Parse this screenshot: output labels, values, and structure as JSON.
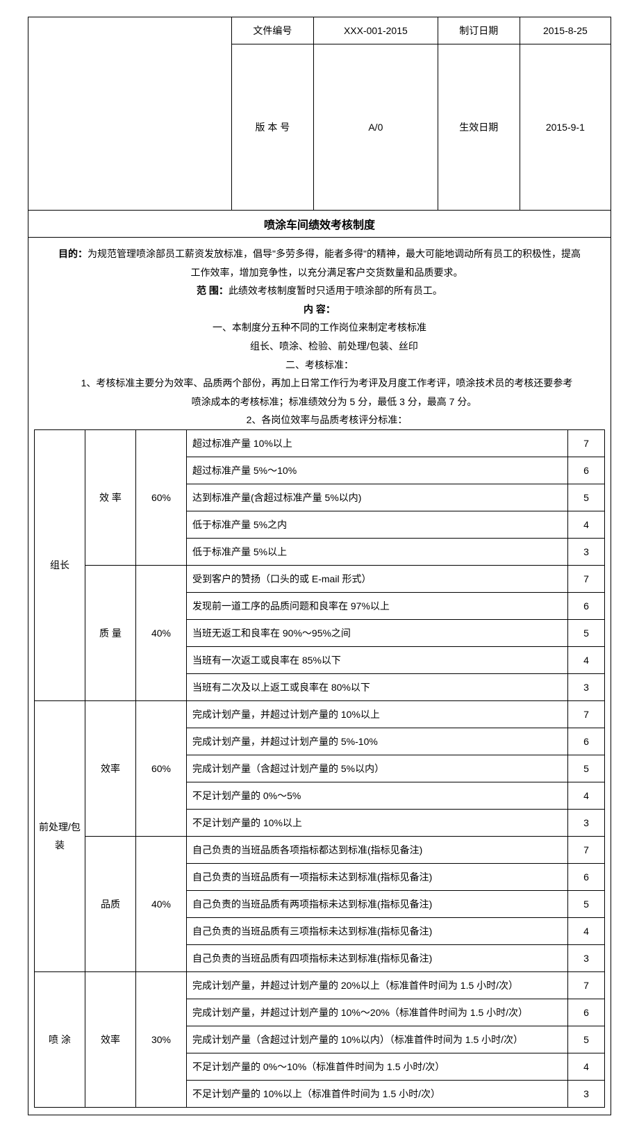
{
  "header": {
    "doc_no_label": "文件编号",
    "doc_no_value": "XXX-001-2015",
    "rev_date_label": "制订日期",
    "rev_date_value": "2015-8-25",
    "version_label": "版 本 号",
    "version_value": "A/0",
    "eff_date_label": "生效日期",
    "eff_date_value": "2015-9-1",
    "title": "喷涂车间绩效考核制度"
  },
  "body": {
    "purpose_label": "目的：",
    "purpose_text_1": "为规范管理喷涂部员工薪资发放标准，倡导\"多劳多得，能者多得\"的精神，最大可能地调动所有员工的积极性，提高",
    "purpose_text_2": "工作效率，增加竞争性，以充分满足客户交货数量和品质要求。",
    "scope_label": "范 围：",
    "scope_text": "此绩效考核制度暂时只适用于喷涂部的所有员工。",
    "content_label": "内 容：",
    "sec1": "一、本制度分五种不同的工作岗位来制定考核标准",
    "sec1_items": "组长、喷涂、检验、前处理/包装、丝印",
    "sec2": "二、考核标准：",
    "sec2_1a": "1、考核标准主要分为效率、品质两个部份，再加上日常工作行为考评及月度工作考评，喷涂技术员的考核还要参考",
    "sec2_1b": "喷涂成本的考核标准；标准绩效分为 5 分，最低 3 分，最高 7 分。",
    "sec2_2": "2、各岗位效率与品质考核评分标准："
  },
  "eval": {
    "groups": [
      {
        "role": "组长",
        "metrics": [
          {
            "name": "效 率",
            "pct": "60%",
            "rows": [
              {
                "desc": "超过标准产量 10%以上",
                "score": "7"
              },
              {
                "desc": "超过标准产量 5%～10%",
                "score": "6"
              },
              {
                "desc": "达到标准产量(含超过标准产量 5%以内)",
                "score": "5"
              },
              {
                "desc": "低于标准产量 5%之内",
                "score": "4"
              },
              {
                "desc": "低于标准产量 5%以上",
                "score": "3"
              }
            ]
          },
          {
            "name": "质 量",
            "pct": "40%",
            "rows": [
              {
                "desc": "受到客户的赞扬（口头的或 E-mail 形式）",
                "score": "7"
              },
              {
                "desc": "发现前一道工序的品质问题和良率在 97%以上",
                "score": "6"
              },
              {
                "desc": "当班无返工和良率在 90%～95%之间",
                "score": "5"
              },
              {
                "desc": "当班有一次返工或良率在 85%以下",
                "score": "4"
              },
              {
                "desc": "当班有二次及以上返工或良率在 80%以下",
                "score": "3"
              }
            ]
          }
        ]
      },
      {
        "role": "前处理/包装",
        "metrics": [
          {
            "name": "效率",
            "pct": "60%",
            "rows": [
              {
                "desc": "完成计划产量，并超过计划产量的 10%以上",
                "score": "7"
              },
              {
                "desc": "完成计划产量，并超过计划产量的 5%-10%",
                "score": "6"
              },
              {
                "desc": "完成计划产量（含超过计划产量的 5%以内）",
                "score": "5"
              },
              {
                "desc": "不足计划产量的 0%～5%",
                "score": "4"
              },
              {
                "desc": "不足计划产量的 10%以上",
                "score": "3"
              }
            ]
          },
          {
            "name": "品质",
            "pct": "40%",
            "rows": [
              {
                "desc": "自己负责的当班品质各项指标都达到标准(指标见备注)",
                "score": "7"
              },
              {
                "desc": "自己负责的当班品质有一项指标未达到标准(指标见备注)",
                "score": "6"
              },
              {
                "desc": "自己负责的当班品质有两项指标未达到标准(指标见备注)",
                "score": "5"
              },
              {
                "desc": "自己负责的当班品质有三项指标未达到标准(指标见备注)",
                "score": "4"
              },
              {
                "desc": "自己负责的当班品质有四项指标未达到标准(指标见备注)",
                "score": "3"
              }
            ]
          }
        ]
      },
      {
        "role": "喷 涂",
        "metrics": [
          {
            "name": "效率",
            "pct": "30%",
            "rows": [
              {
                "desc": "完成计划产量，并超过计划产量的 20%以上（标准首件时间为 1.5 小时/次）",
                "score": "7"
              },
              {
                "desc": "完成计划产量，并超过计划产量的 10%～20%（标准首件时间为 1.5 小时/次）",
                "score": "6"
              },
              {
                "desc": "完成计划产量（含超过计划产量的 10%以内）（标准首件时间为 1.5 小时/次）",
                "score": "5"
              },
              {
                "desc": "不足计划产量的 0%～10%（标准首件时间为 1.5 小时/次）",
                "score": "4"
              },
              {
                "desc": "不足计划产量的 10%以上（标准首件时间为 1.5 小时/次）",
                "score": "3"
              }
            ]
          }
        ]
      }
    ]
  }
}
